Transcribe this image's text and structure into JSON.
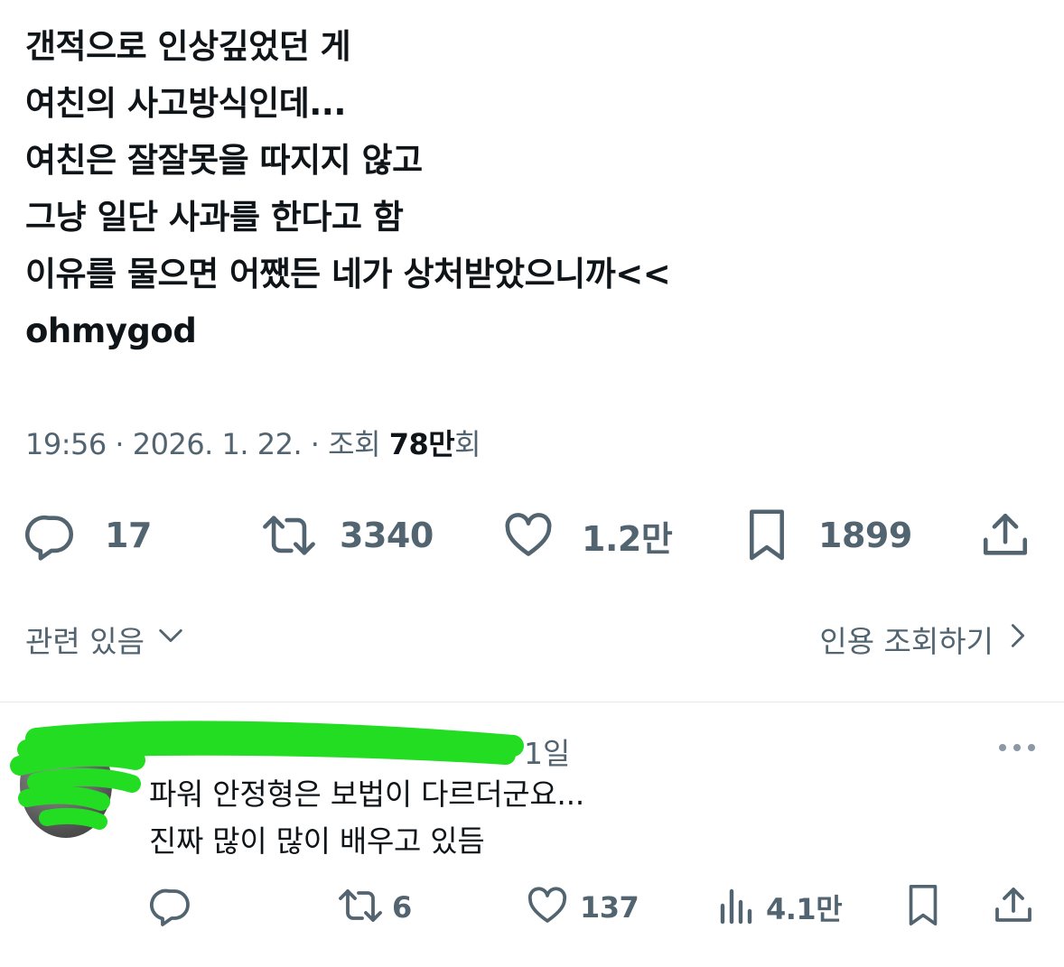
{
  "tweet": {
    "lines": [
      "갠적으로 인상깊었던 게",
      "여친의 사고방식인데...",
      "여친은 잘잘못을 따지지 않고",
      "그냥 일단 사과를 한다고 함",
      "이유를 물으면 어쨌든 네가 상처받았으니까<<",
      "ohmygod"
    ],
    "time": "19:56",
    "date": "2026. 1. 22.",
    "views_prefix": "조회",
    "views_count": "78",
    "views_unit": "만",
    "views_suffix": "회"
  },
  "actions": {
    "replies": "17",
    "retweets": "3340",
    "likes": "1.2만",
    "bookmarks": "1899"
  },
  "links": {
    "related": "관련 있음",
    "quotes": "인용 조회하기"
  },
  "reply": {
    "time": "1일",
    "lines": [
      "파워 안정형은 보법이 다르더군요...",
      "진짜 많이 많이 배우고 있듬"
    ],
    "retweets": "6",
    "likes": "137",
    "views": "4.1만"
  },
  "colors": {
    "text": "#0f1419",
    "secondary": "#536471",
    "divider": "#e4e7ea",
    "scribble": "#22dd22"
  }
}
